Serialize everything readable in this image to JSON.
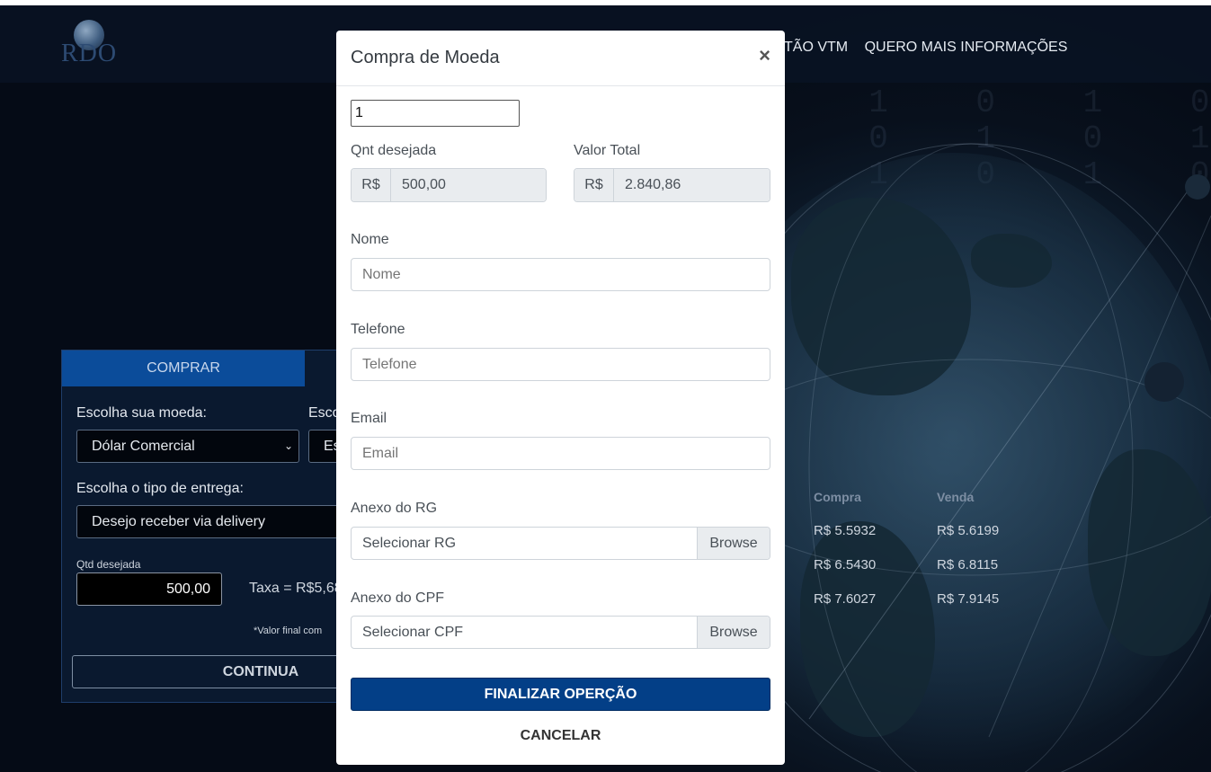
{
  "header": {
    "nav_links": [
      "TÃO VTM",
      "QUERO MAIS INFORMAÇÕES"
    ]
  },
  "rates": {
    "head_buy": "Compra",
    "head_sell": "Venda",
    "rows": [
      {
        "buy": "R$ 5.5932",
        "sell": "R$ 5.6199"
      },
      {
        "buy": "R$ 6.5430",
        "sell": "R$ 6.8115"
      },
      {
        "buy": "R$ 7.6027",
        "sell": "R$ 7.9145"
      }
    ]
  },
  "panel": {
    "tab_buy": "COMPRAR",
    "label_currency": "Escolha sua moeda:",
    "label_second": "Esco",
    "currency_value": "Dólar Comercial",
    "second_value": "Es",
    "label_delivery": "Escolha o tipo de entrega:",
    "delivery_value": "Desejo receber via delivery",
    "qty_label": "Qtd desejada",
    "qty_value": "500,00",
    "taxa": "Taxa = R$5,68",
    "valor_final": "*Valor final com",
    "continuar": "CONTINUA"
  },
  "modal": {
    "title": "Compra de Moeda",
    "close": "×",
    "qty_input_value": "1",
    "label_qnt": "Qnt desejada",
    "label_total": "Valor Total",
    "prefix": "R$",
    "qnt_value": "500,00",
    "total_value": "2.840,86",
    "label_nome": "Nome",
    "ph_nome": "Nome",
    "label_telefone": "Telefone",
    "ph_telefone": "Telefone",
    "label_email": "Email",
    "ph_email": "Email",
    "label_rg": "Anexo do RG",
    "rg_text": "Selecionar RG",
    "label_cpf": "Anexo do CPF",
    "cpf_text": "Selecionar CPF",
    "browse": "Browse",
    "finalizar": "FINALIZAR OPERÇÃO",
    "cancelar": "CANCELAR"
  }
}
